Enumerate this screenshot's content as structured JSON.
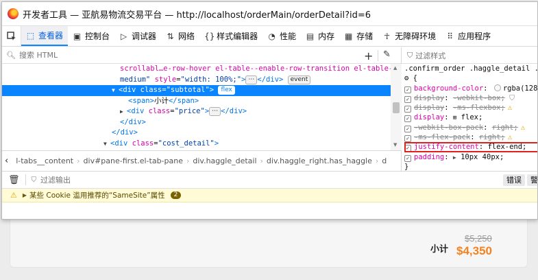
{
  "window": {
    "title": "开发者工具 — 亚航易物流交易平台 — http://localhost/orderMain/orderDetail?id=6"
  },
  "tabs": [
    {
      "label": "查看器",
      "icon": "inspector-icon",
      "active": true
    },
    {
      "label": "控制台",
      "icon": "console-icon"
    },
    {
      "label": "调试器",
      "icon": "debugger-icon"
    },
    {
      "label": "网络",
      "icon": "network-icon"
    },
    {
      "label": "样式编辑器",
      "icon": "style-editor-icon"
    },
    {
      "label": "性能",
      "icon": "performance-icon"
    },
    {
      "label": "内存",
      "icon": "memory-icon"
    },
    {
      "label": "存储",
      "icon": "storage-icon"
    },
    {
      "label": "无障碍环境",
      "icon": "accessibility-icon"
    },
    {
      "label": "应用程序",
      "icon": "application-icon"
    }
  ],
  "inspector": {
    "search_placeholder": "搜索 HTML",
    "markup": {
      "l1_text": "scrollabl…e-row-hover el-table--enable-row-transition el-table--",
      "l2_val": "medium\"",
      "l2_attr": "style",
      "l2_attrval": "\"width: 100%;\"",
      "l2_close": "</div>",
      "l2_badge": "event",
      "l3_open": "<div",
      "l3_attr": "class",
      "l3_val": "\"subtotal\"",
      "l3_close": ">",
      "l3_badge": "flex",
      "l4_open": "<span>",
      "l4_text": "小计",
      "l4_close": "</span>",
      "l5_open": "<div",
      "l5_attr": "class",
      "l5_val": "\"price\"",
      "l5_close": "</div>",
      "l6": "</div>",
      "l7": "</div>",
      "l8_open": "<div",
      "l8_attr": "class",
      "l8_val": "\"cost_detail\"",
      "l8_close": ">"
    },
    "breadcrumbs": [
      "l-tabs__content",
      "div#pane-first.el-tab-pane",
      "div.haggle_detail",
      "div.haggle_right.has_haggle",
      "d"
    ]
  },
  "rules": {
    "filter_placeholder": "过滤样式",
    "selector": ".confirm_order .haggle_detail .ha",
    "brace": "{",
    "declarations": [
      {
        "name": "background-color",
        "value": "rgba(128,",
        "enabled": true,
        "overridden": false
      },
      {
        "name": "display",
        "value": "-webkit-box;",
        "enabled": true,
        "overridden": true
      },
      {
        "name": "display",
        "value": "-ms-flexbox;",
        "enabled": true,
        "overridden": true
      },
      {
        "name": "display",
        "value": "flex;",
        "enabled": true,
        "overridden": false
      },
      {
        "name": "-webkit-box-pack",
        "value": "right;",
        "enabled": true,
        "overridden": true
      },
      {
        "name": "-ms-flex-pack",
        "value": "right;",
        "enabled": true,
        "overridden": true
      },
      {
        "name": "justify-content",
        "value": "flex-end;",
        "enabled": true,
        "overridden": false,
        "highlighted": true
      },
      {
        "name": "padding",
        "value": "10px 40px;",
        "enabled": true,
        "overridden": false
      },
      {
        "name": "}",
        "value": ""
      }
    ],
    "highlight_color": "#e0201b"
  },
  "console": {
    "filter_placeholder": "过滤输出",
    "buttons": [
      "错误",
      "警"
    ],
    "message": "某些 Cookie 滥用推荐的“SameSite”属性",
    "message_count": "2"
  },
  "page": {
    "subtotal_label": "小计",
    "old_price": "$5,250",
    "new_price": "$4,350"
  },
  "colors": {
    "accent": "#0a84ff",
    "price": "#f5811f",
    "warning_bg": "#fffbd6"
  }
}
